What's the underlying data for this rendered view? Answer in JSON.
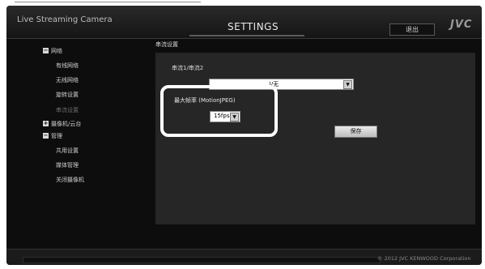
{
  "header": {
    "app_title": "Live Streaming Camera",
    "page_title": "SETTINGS",
    "logout_label": "退出",
    "brand": "JVC"
  },
  "sidebar": {
    "groups": [
      {
        "toggle": "−",
        "label": "网络",
        "items": [
          "有线网络",
          "无线网络",
          "旋转设置",
          "串流设置"
        ]
      },
      {
        "toggle": "+",
        "label": "摄像机/云台",
        "items": []
      },
      {
        "toggle": "−",
        "label": "管理",
        "items": [
          "共用设置",
          "媒体管理",
          "关闭摄像机"
        ]
      }
    ]
  },
  "main": {
    "section_title": "串流设置",
    "stream_tabs": "串流1/串流2",
    "stream_select_value": ")/无",
    "max_frame_rate_label": "最大帧率 (MotionJPEG)",
    "fps_value": "15fps",
    "save_label": "保存"
  },
  "footer": {
    "copyright": "© 2012 JVC KENWOOD Corporation"
  },
  "colors": {
    "background": "#0d0d0d",
    "panel": "#262626",
    "callout_border": "#ffffff"
  }
}
